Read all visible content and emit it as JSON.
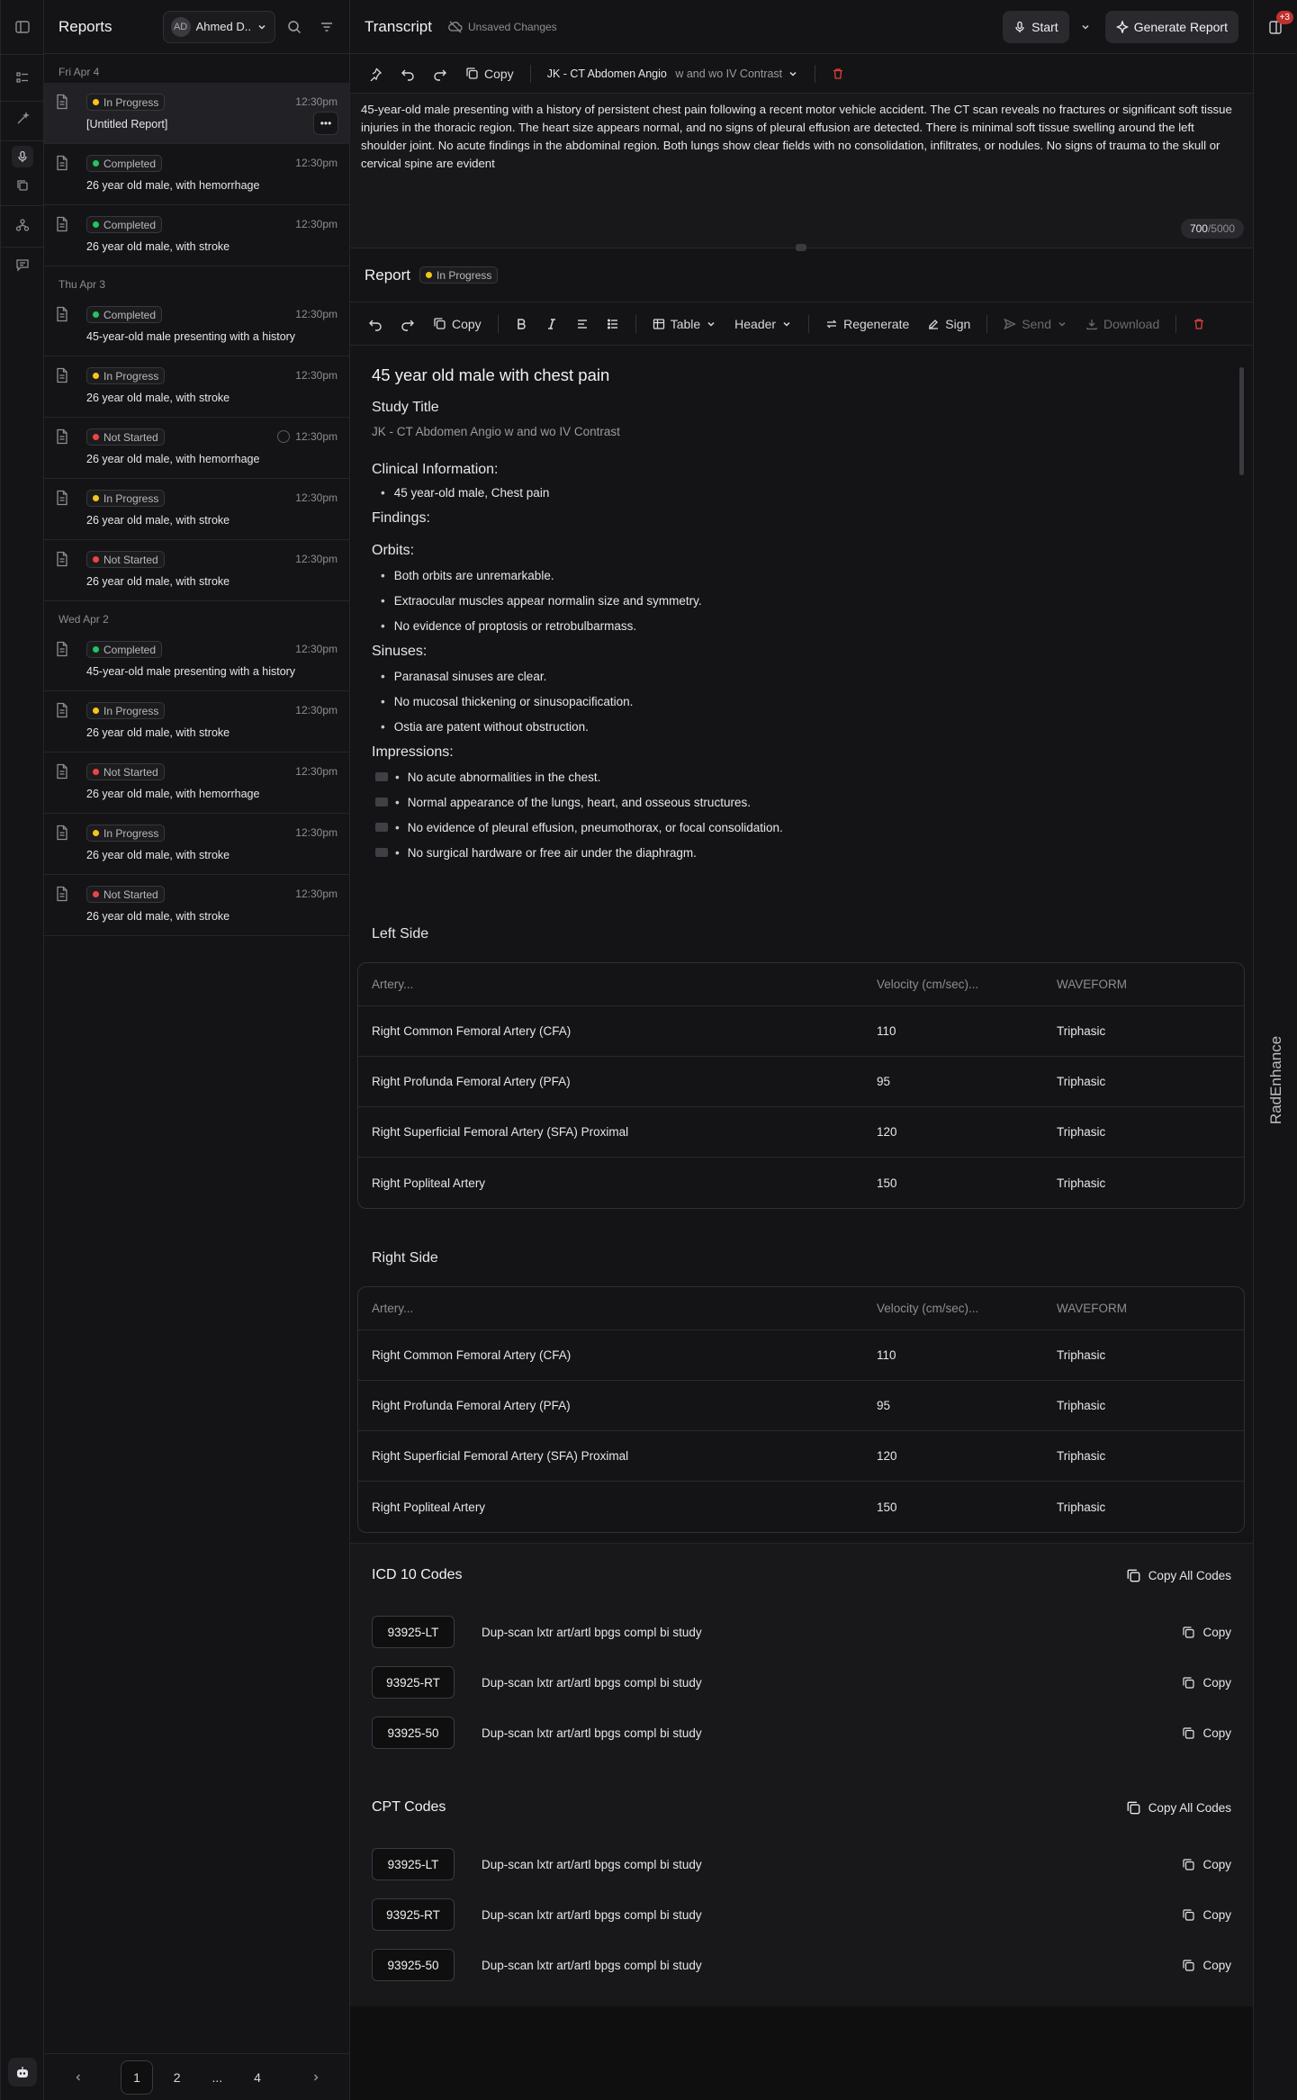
{
  "sidebar": {
    "title": "Reports",
    "user": {
      "initials": "AD",
      "name": "Ahmed D.."
    },
    "groups": [
      {
        "date": "Fri Apr 4",
        "items": [
          {
            "status": "In Progress",
            "status_color": "#f5c518",
            "time": "12:30pm",
            "name": "[Untitled Report]"
          },
          {
            "status": "Completed",
            "status_color": "#22c55e",
            "time": "12:30pm",
            "name": "26 year old male, with hemorrhage"
          },
          {
            "status": "Completed",
            "status_color": "#22c55e",
            "time": "12:30pm",
            "name": "26 year old male, with stroke"
          }
        ]
      },
      {
        "date": "Thu Apr 3",
        "items": [
          {
            "status": "Completed",
            "status_color": "#22c55e",
            "time": "12:30pm",
            "name": "45-year-old male presenting with a history"
          },
          {
            "status": "In Progress",
            "status_color": "#f5c518",
            "time": "12:30pm",
            "name": "26 year old male, with stroke"
          },
          {
            "status": "Not Started",
            "status_color": "#ef4444",
            "time": "12:30pm",
            "name": "26 year old male, with hemorrhage"
          },
          {
            "status": "In Progress",
            "status_color": "#f5c518",
            "time": "12:30pm",
            "name": "26 year old male, with stroke"
          },
          {
            "status": "Not Started",
            "status_color": "#ef4444",
            "time": "12:30pm",
            "name": "26 year old male, with stroke"
          }
        ]
      },
      {
        "date": "Wed Apr 2",
        "items": [
          {
            "status": "Completed",
            "status_color": "#22c55e",
            "time": "12:30pm",
            "name": "45-year-old male presenting with a history"
          },
          {
            "status": "In Progress",
            "status_color": "#f5c518",
            "time": "12:30pm",
            "name": "26 year old male, with stroke"
          },
          {
            "status": "Not Started",
            "status_color": "#ef4444",
            "time": "12:30pm",
            "name": "26 year old male, with hemorrhage"
          },
          {
            "status": "In Progress",
            "status_color": "#f5c518",
            "time": "12:30pm",
            "name": "26 year old male, with stroke"
          },
          {
            "status": "Not Started",
            "status_color": "#ef4444",
            "time": "12:30pm",
            "name": "26 year old male, with stroke"
          }
        ]
      }
    ],
    "pager": {
      "pages": [
        "1",
        "2",
        "...",
        "4"
      ],
      "current": "1"
    }
  },
  "topbar": {
    "title": "Transcript",
    "unsaved": "Unsaved Changes",
    "start": "Start",
    "generate": "Generate Report"
  },
  "transcript_toolbar": {
    "copy": "Copy",
    "study_strong": "JK - CT Abdomen Angio",
    "study_rest": " w and wo IV Contrast"
  },
  "transcript": {
    "text": "45-year-old male presenting with a history of persistent chest pain following a recent motor vehicle accident. The CT scan reveals no fractures or significant soft tissue injuries in the thoracic region. The heart size appears normal, and no signs of pleural effusion are detected. There is minimal soft tissue swelling around the left shoulder joint. No acute findings in the abdominal region. Both lungs show clear fields with no consolidation, infiltrates, or nodules. No signs of trauma to the skull or cervical spine are evident",
    "count": "700",
    "max": "/5000"
  },
  "report": {
    "title": "Report",
    "status": "In Progress",
    "status_color": "#f5c518",
    "toolbar": {
      "copy": "Copy",
      "table": "Table",
      "header": "Header",
      "regenerate": "Regenerate",
      "sign": "Sign",
      "send": "Send",
      "download": "Download"
    },
    "heading": "45 year old male with chest pain",
    "study_title_label": "Study Title",
    "study_title": "JK - CT Abdomen Angio w and wo IV Contrast",
    "clinical_label": "Clinical Information:",
    "clinical": [
      "45 year-old male, Chest pain"
    ],
    "findings_label": "Findings:",
    "orbits_label": "Orbits:",
    "orbits": [
      "Both orbits are unremarkable.",
      "Extraocular muscles appear normalin size and symmetry.",
      "No evidence of proptosis or retrobulbarmass."
    ],
    "sinuses_label": "Sinuses:",
    "sinuses": [
      "Paranasal sinuses are clear.",
      "No mucosal thickening or sinusopacification.",
      "Ostia are patent without obstruction."
    ],
    "impressions_label": "Impressions:",
    "impressions": [
      "No acute abnormalities in the chest.",
      "Normal appearance of the lungs, heart, and osseous structures.",
      "No evidence of pleural effusion, pneumothorax, or focal consolidation.",
      "No surgical hardware or free air under the diaphragm."
    ]
  },
  "tables": [
    {
      "title": "Left Side",
      "headers": [
        "Artery...",
        "Velocity (cm/sec)...",
        "WAVEFORM"
      ],
      "rows": [
        [
          "Right Common Femoral Artery (CFA)",
          "110",
          "Triphasic"
        ],
        [
          "Right Profunda Femoral Artery (PFA)",
          "95",
          "Triphasic"
        ],
        [
          "Right Superficial Femoral Artery (SFA) Proximal",
          "120",
          "Triphasic"
        ],
        [
          "Right Popliteal Artery",
          "150",
          "Triphasic"
        ]
      ]
    },
    {
      "title": "Right Side",
      "headers": [
        "Artery...",
        "Velocity (cm/sec)...",
        "WAVEFORM"
      ],
      "rows": [
        [
          "Right Common Femoral Artery (CFA)",
          "110",
          "Triphasic"
        ],
        [
          "Right Profunda Femoral Artery (PFA)",
          "95",
          "Triphasic"
        ],
        [
          "Right Superficial Femoral Artery (SFA) Proximal",
          "120",
          "Triphasic"
        ],
        [
          "Right Popliteal Artery",
          "150",
          "Triphasic"
        ]
      ]
    }
  ],
  "icd": {
    "title": "ICD 10 Codes",
    "copy_all": "Copy All Codes",
    "copy": "Copy",
    "rows": [
      {
        "code": "93925-LT",
        "desc": "Dup-scan lxtr art/artl bpgs compl bi study"
      },
      {
        "code": "93925-RT",
        "desc": "Dup-scan lxtr art/artl bpgs compl bi study"
      },
      {
        "code": "93925-50",
        "desc": "Dup-scan lxtr art/artl bpgs compl bi study"
      }
    ]
  },
  "cpt": {
    "title": "CPT Codes",
    "copy_all": "Copy All Codes",
    "copy": "Copy",
    "rows": [
      {
        "code": "93925-LT",
        "desc": "Dup-scan lxtr art/artl bpgs compl bi study"
      },
      {
        "code": "93925-RT",
        "desc": "Dup-scan lxtr art/artl bpgs compl bi study"
      },
      {
        "code": "93925-50",
        "desc": "Dup-scan lxtr art/artl bpgs compl bi study"
      }
    ]
  },
  "rightbar": {
    "notifications": "+3",
    "label": "RadEnhance"
  }
}
